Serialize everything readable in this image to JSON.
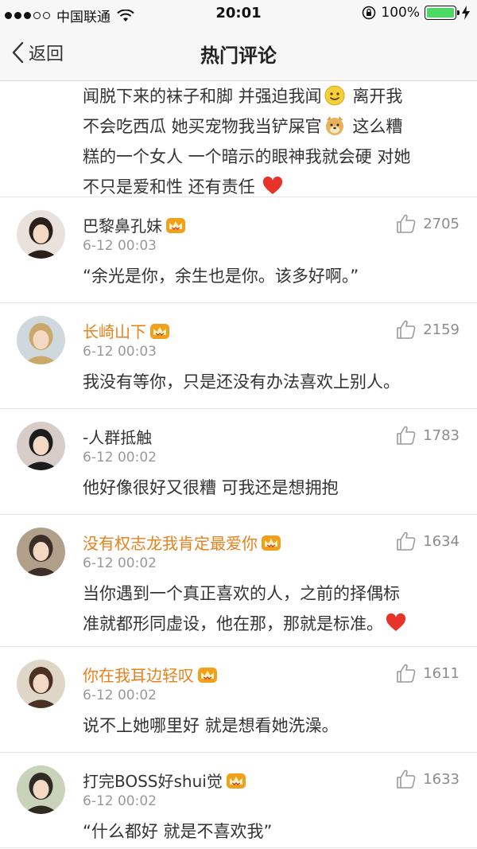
{
  "status_bar": {
    "carrier": "中国联通",
    "time": "20:01",
    "battery": "100%"
  },
  "nav": {
    "back_label": "返回",
    "title": "热门评论"
  },
  "partial_comment": {
    "lines": [
      [
        "闻脱下来的袜子和脚 并强迫我闻",
        "smile-emoji",
        " 离开我"
      ],
      [
        "不会吃西瓜 她买宠物我当铲屎官",
        "doge-emoji",
        " 这么糟"
      ],
      [
        "糕的一个女人 一个暗示的眼神我就会硬 对她"
      ],
      [
        "不只是爱和性 还有责任 ",
        "heart-emoji",
        ""
      ]
    ]
  },
  "comments": [
    {
      "username": "巴黎鼻孔妹",
      "vip": false,
      "time": "6-12 00:03",
      "likes": "2705",
      "text_lines": [
        "“余光是你，余生也是你。该多好啊。”"
      ],
      "trailing_heart": false
    },
    {
      "username": "长崎山下",
      "vip": true,
      "time": "6-12 00:03",
      "likes": "2159",
      "text_lines": [
        "我没有等你，只是还没有办法喜欢上别人。"
      ],
      "trailing_heart": false
    },
    {
      "username": "-人群抵触",
      "vip": false,
      "time": "6-12 00:02",
      "likes": "1783",
      "text_lines": [
        "他好像很好又很糟 可我还是想拥抱"
      ],
      "trailing_heart": false
    },
    {
      "username": "没有权志龙我肯定最爱你",
      "vip": true,
      "time": "6-12 00:02",
      "likes": "1634",
      "text_lines": [
        "当你遇到一个真正喜欢的人，之前的择偶标",
        "准就都形同虚设，他在那，那就是标准。"
      ],
      "trailing_heart": true
    },
    {
      "username": "你在我耳边轻叹",
      "vip": true,
      "time": "6-12 00:02",
      "likes": "1611",
      "text_lines": [
        "说不上她哪里好 就是想看她洗澡。"
      ],
      "trailing_heart": false
    },
    {
      "username": "打完BOSS好shui觉",
      "vip": false,
      "time": "6-12 00:02",
      "likes": "1633",
      "text_lines": [
        "“什么都好 就是不喜欢我”"
      ],
      "trailing_heart": false
    }
  ],
  "colors": {
    "vip_name": "#e8811c",
    "crown": "#f2a019",
    "heart": "#e8332b",
    "battery": "#4cd964"
  },
  "icons": {
    "back": "chevron-left-icon",
    "like": "thumb-up-icon",
    "crown": "crown-icon",
    "wifi": "wifi-icon",
    "lock": "rotation-lock-icon",
    "battery": "battery-icon",
    "bolt": "charging-bolt-icon"
  }
}
